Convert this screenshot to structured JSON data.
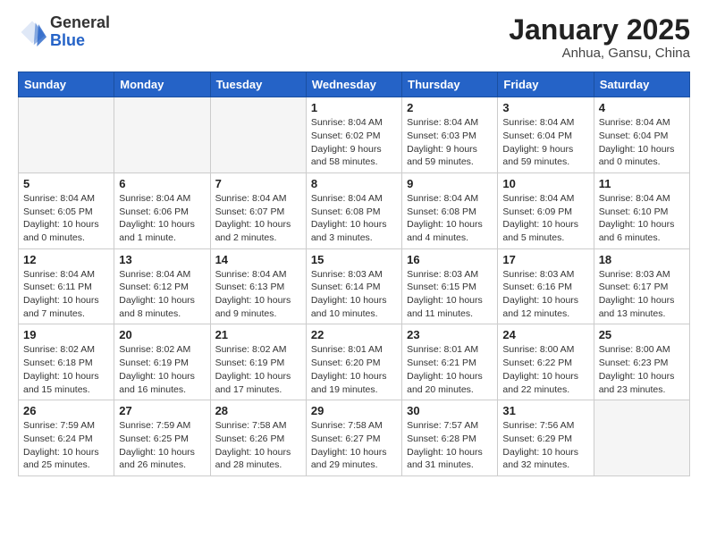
{
  "header": {
    "logo_line1": "General",
    "logo_line2": "Blue",
    "title": "January 2025",
    "subtitle": "Anhua, Gansu, China"
  },
  "days_of_week": [
    "Sunday",
    "Monday",
    "Tuesday",
    "Wednesday",
    "Thursday",
    "Friday",
    "Saturday"
  ],
  "weeks": [
    [
      {
        "day": "",
        "info": ""
      },
      {
        "day": "",
        "info": ""
      },
      {
        "day": "",
        "info": ""
      },
      {
        "day": "1",
        "info": "Sunrise: 8:04 AM\nSunset: 6:02 PM\nDaylight: 9 hours\nand 58 minutes."
      },
      {
        "day": "2",
        "info": "Sunrise: 8:04 AM\nSunset: 6:03 PM\nDaylight: 9 hours\nand 59 minutes."
      },
      {
        "day": "3",
        "info": "Sunrise: 8:04 AM\nSunset: 6:04 PM\nDaylight: 9 hours\nand 59 minutes."
      },
      {
        "day": "4",
        "info": "Sunrise: 8:04 AM\nSunset: 6:04 PM\nDaylight: 10 hours\nand 0 minutes."
      }
    ],
    [
      {
        "day": "5",
        "info": "Sunrise: 8:04 AM\nSunset: 6:05 PM\nDaylight: 10 hours\nand 0 minutes."
      },
      {
        "day": "6",
        "info": "Sunrise: 8:04 AM\nSunset: 6:06 PM\nDaylight: 10 hours\nand 1 minute."
      },
      {
        "day": "7",
        "info": "Sunrise: 8:04 AM\nSunset: 6:07 PM\nDaylight: 10 hours\nand 2 minutes."
      },
      {
        "day": "8",
        "info": "Sunrise: 8:04 AM\nSunset: 6:08 PM\nDaylight: 10 hours\nand 3 minutes."
      },
      {
        "day": "9",
        "info": "Sunrise: 8:04 AM\nSunset: 6:08 PM\nDaylight: 10 hours\nand 4 minutes."
      },
      {
        "day": "10",
        "info": "Sunrise: 8:04 AM\nSunset: 6:09 PM\nDaylight: 10 hours\nand 5 minutes."
      },
      {
        "day": "11",
        "info": "Sunrise: 8:04 AM\nSunset: 6:10 PM\nDaylight: 10 hours\nand 6 minutes."
      }
    ],
    [
      {
        "day": "12",
        "info": "Sunrise: 8:04 AM\nSunset: 6:11 PM\nDaylight: 10 hours\nand 7 minutes."
      },
      {
        "day": "13",
        "info": "Sunrise: 8:04 AM\nSunset: 6:12 PM\nDaylight: 10 hours\nand 8 minutes."
      },
      {
        "day": "14",
        "info": "Sunrise: 8:04 AM\nSunset: 6:13 PM\nDaylight: 10 hours\nand 9 minutes."
      },
      {
        "day": "15",
        "info": "Sunrise: 8:03 AM\nSunset: 6:14 PM\nDaylight: 10 hours\nand 10 minutes."
      },
      {
        "day": "16",
        "info": "Sunrise: 8:03 AM\nSunset: 6:15 PM\nDaylight: 10 hours\nand 11 minutes."
      },
      {
        "day": "17",
        "info": "Sunrise: 8:03 AM\nSunset: 6:16 PM\nDaylight: 10 hours\nand 12 minutes."
      },
      {
        "day": "18",
        "info": "Sunrise: 8:03 AM\nSunset: 6:17 PM\nDaylight: 10 hours\nand 13 minutes."
      }
    ],
    [
      {
        "day": "19",
        "info": "Sunrise: 8:02 AM\nSunset: 6:18 PM\nDaylight: 10 hours\nand 15 minutes."
      },
      {
        "day": "20",
        "info": "Sunrise: 8:02 AM\nSunset: 6:19 PM\nDaylight: 10 hours\nand 16 minutes."
      },
      {
        "day": "21",
        "info": "Sunrise: 8:02 AM\nSunset: 6:19 PM\nDaylight: 10 hours\nand 17 minutes."
      },
      {
        "day": "22",
        "info": "Sunrise: 8:01 AM\nSunset: 6:20 PM\nDaylight: 10 hours\nand 19 minutes."
      },
      {
        "day": "23",
        "info": "Sunrise: 8:01 AM\nSunset: 6:21 PM\nDaylight: 10 hours\nand 20 minutes."
      },
      {
        "day": "24",
        "info": "Sunrise: 8:00 AM\nSunset: 6:22 PM\nDaylight: 10 hours\nand 22 minutes."
      },
      {
        "day": "25",
        "info": "Sunrise: 8:00 AM\nSunset: 6:23 PM\nDaylight: 10 hours\nand 23 minutes."
      }
    ],
    [
      {
        "day": "26",
        "info": "Sunrise: 7:59 AM\nSunset: 6:24 PM\nDaylight: 10 hours\nand 25 minutes."
      },
      {
        "day": "27",
        "info": "Sunrise: 7:59 AM\nSunset: 6:25 PM\nDaylight: 10 hours\nand 26 minutes."
      },
      {
        "day": "28",
        "info": "Sunrise: 7:58 AM\nSunset: 6:26 PM\nDaylight: 10 hours\nand 28 minutes."
      },
      {
        "day": "29",
        "info": "Sunrise: 7:58 AM\nSunset: 6:27 PM\nDaylight: 10 hours\nand 29 minutes."
      },
      {
        "day": "30",
        "info": "Sunrise: 7:57 AM\nSunset: 6:28 PM\nDaylight: 10 hours\nand 31 minutes."
      },
      {
        "day": "31",
        "info": "Sunrise: 7:56 AM\nSunset: 6:29 PM\nDaylight: 10 hours\nand 32 minutes."
      },
      {
        "day": "",
        "info": ""
      }
    ]
  ]
}
